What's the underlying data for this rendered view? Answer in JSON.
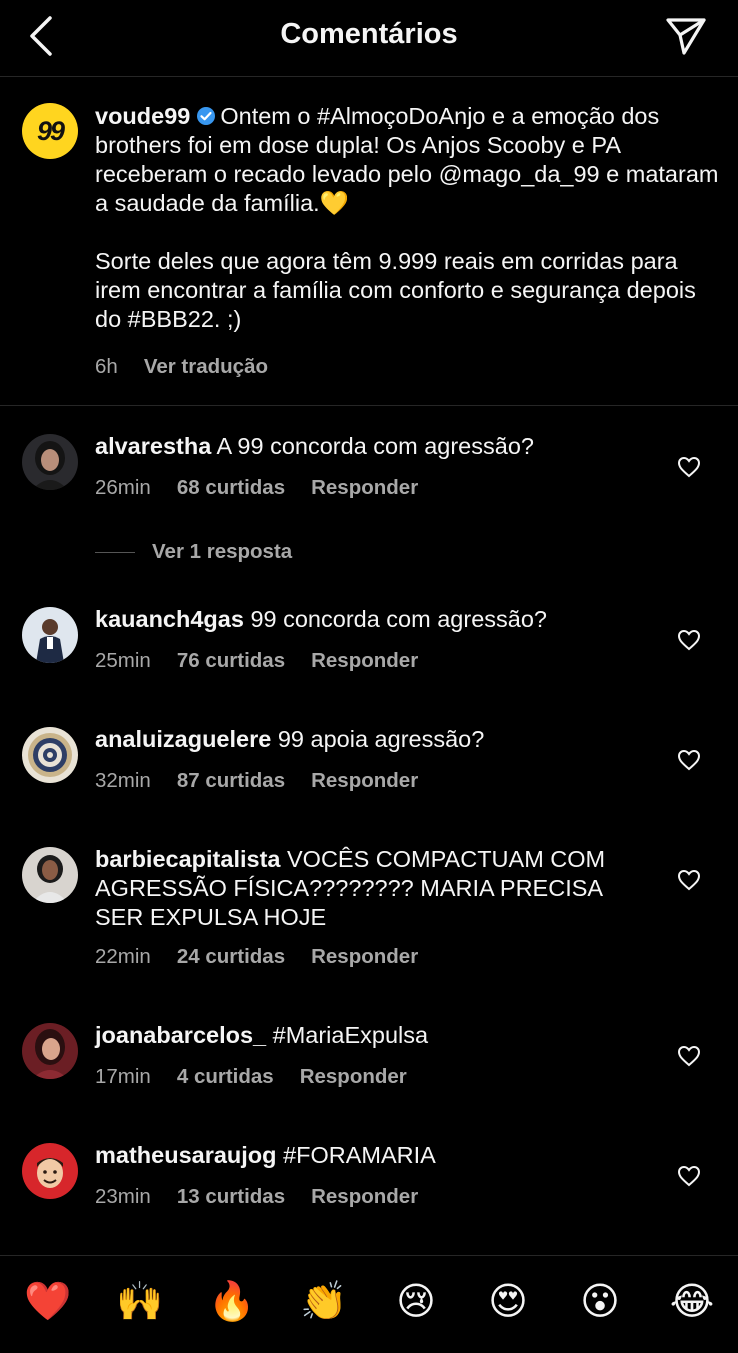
{
  "header": {
    "title": "Comentários",
    "back_icon": "chevron-left-icon",
    "share_icon": "paper-plane-icon"
  },
  "caption": {
    "avatar_text": "99",
    "username": "voude99",
    "text": "Ontem o #AlmoçoDoAnjo e a emoção dos brothers foi em dose dupla! Os Anjos Scooby e PA receberam o recado levado pelo @mago_da_99 e mataram a saudade da família.💛\n\nSorte deles que agora têm 9.999 reais em corridas para irem encontrar a família com conforto e segurança depois do #BBB22. ;)",
    "time": "6h",
    "translate": "Ver tradução"
  },
  "comments": [
    {
      "username": "alvarestha",
      "text": "A 99 concorda com agressão?",
      "time": "26min",
      "likes": "68 curtidas",
      "reply": "Responder"
    },
    {
      "username": "kauanch4gas",
      "text": "99 concorda com agressão?",
      "time": "25min",
      "likes": "76 curtidas",
      "reply": "Responder"
    },
    {
      "username": "analuizaguelere",
      "text": "99 apoia agressão?",
      "time": "32min",
      "likes": "87 curtidas",
      "reply": "Responder"
    },
    {
      "username": "barbiecapitalista",
      "text": "VOCÊS COMPACTUAM COM AGRESSÃO FÍSICA???????? MARIA PRECISA SER EXPULSA HOJE",
      "time": "22min",
      "likes": "24 curtidas",
      "reply": "Responder"
    },
    {
      "username": "joanabarcelos_",
      "text": "#MariaExpulsa",
      "time": "17min",
      "likes": "4 curtidas",
      "reply": "Responder"
    },
    {
      "username": "matheusaraujog",
      "text": "#FORAMARIA",
      "time": "23min",
      "likes": "13 curtidas",
      "reply": "Responder"
    }
  ],
  "view_replies": "Ver 1 resposta",
  "emoji_bar": [
    "❤️",
    "🙌",
    "🔥",
    "👏",
    "😢",
    "😍",
    "😮",
    "😂"
  ],
  "colors": {
    "background": "#000000",
    "text": "#f5f5f5",
    "secondary": "#a8a8a8",
    "verified": "#3897f0",
    "brand_yellow": "#ffd51f"
  }
}
